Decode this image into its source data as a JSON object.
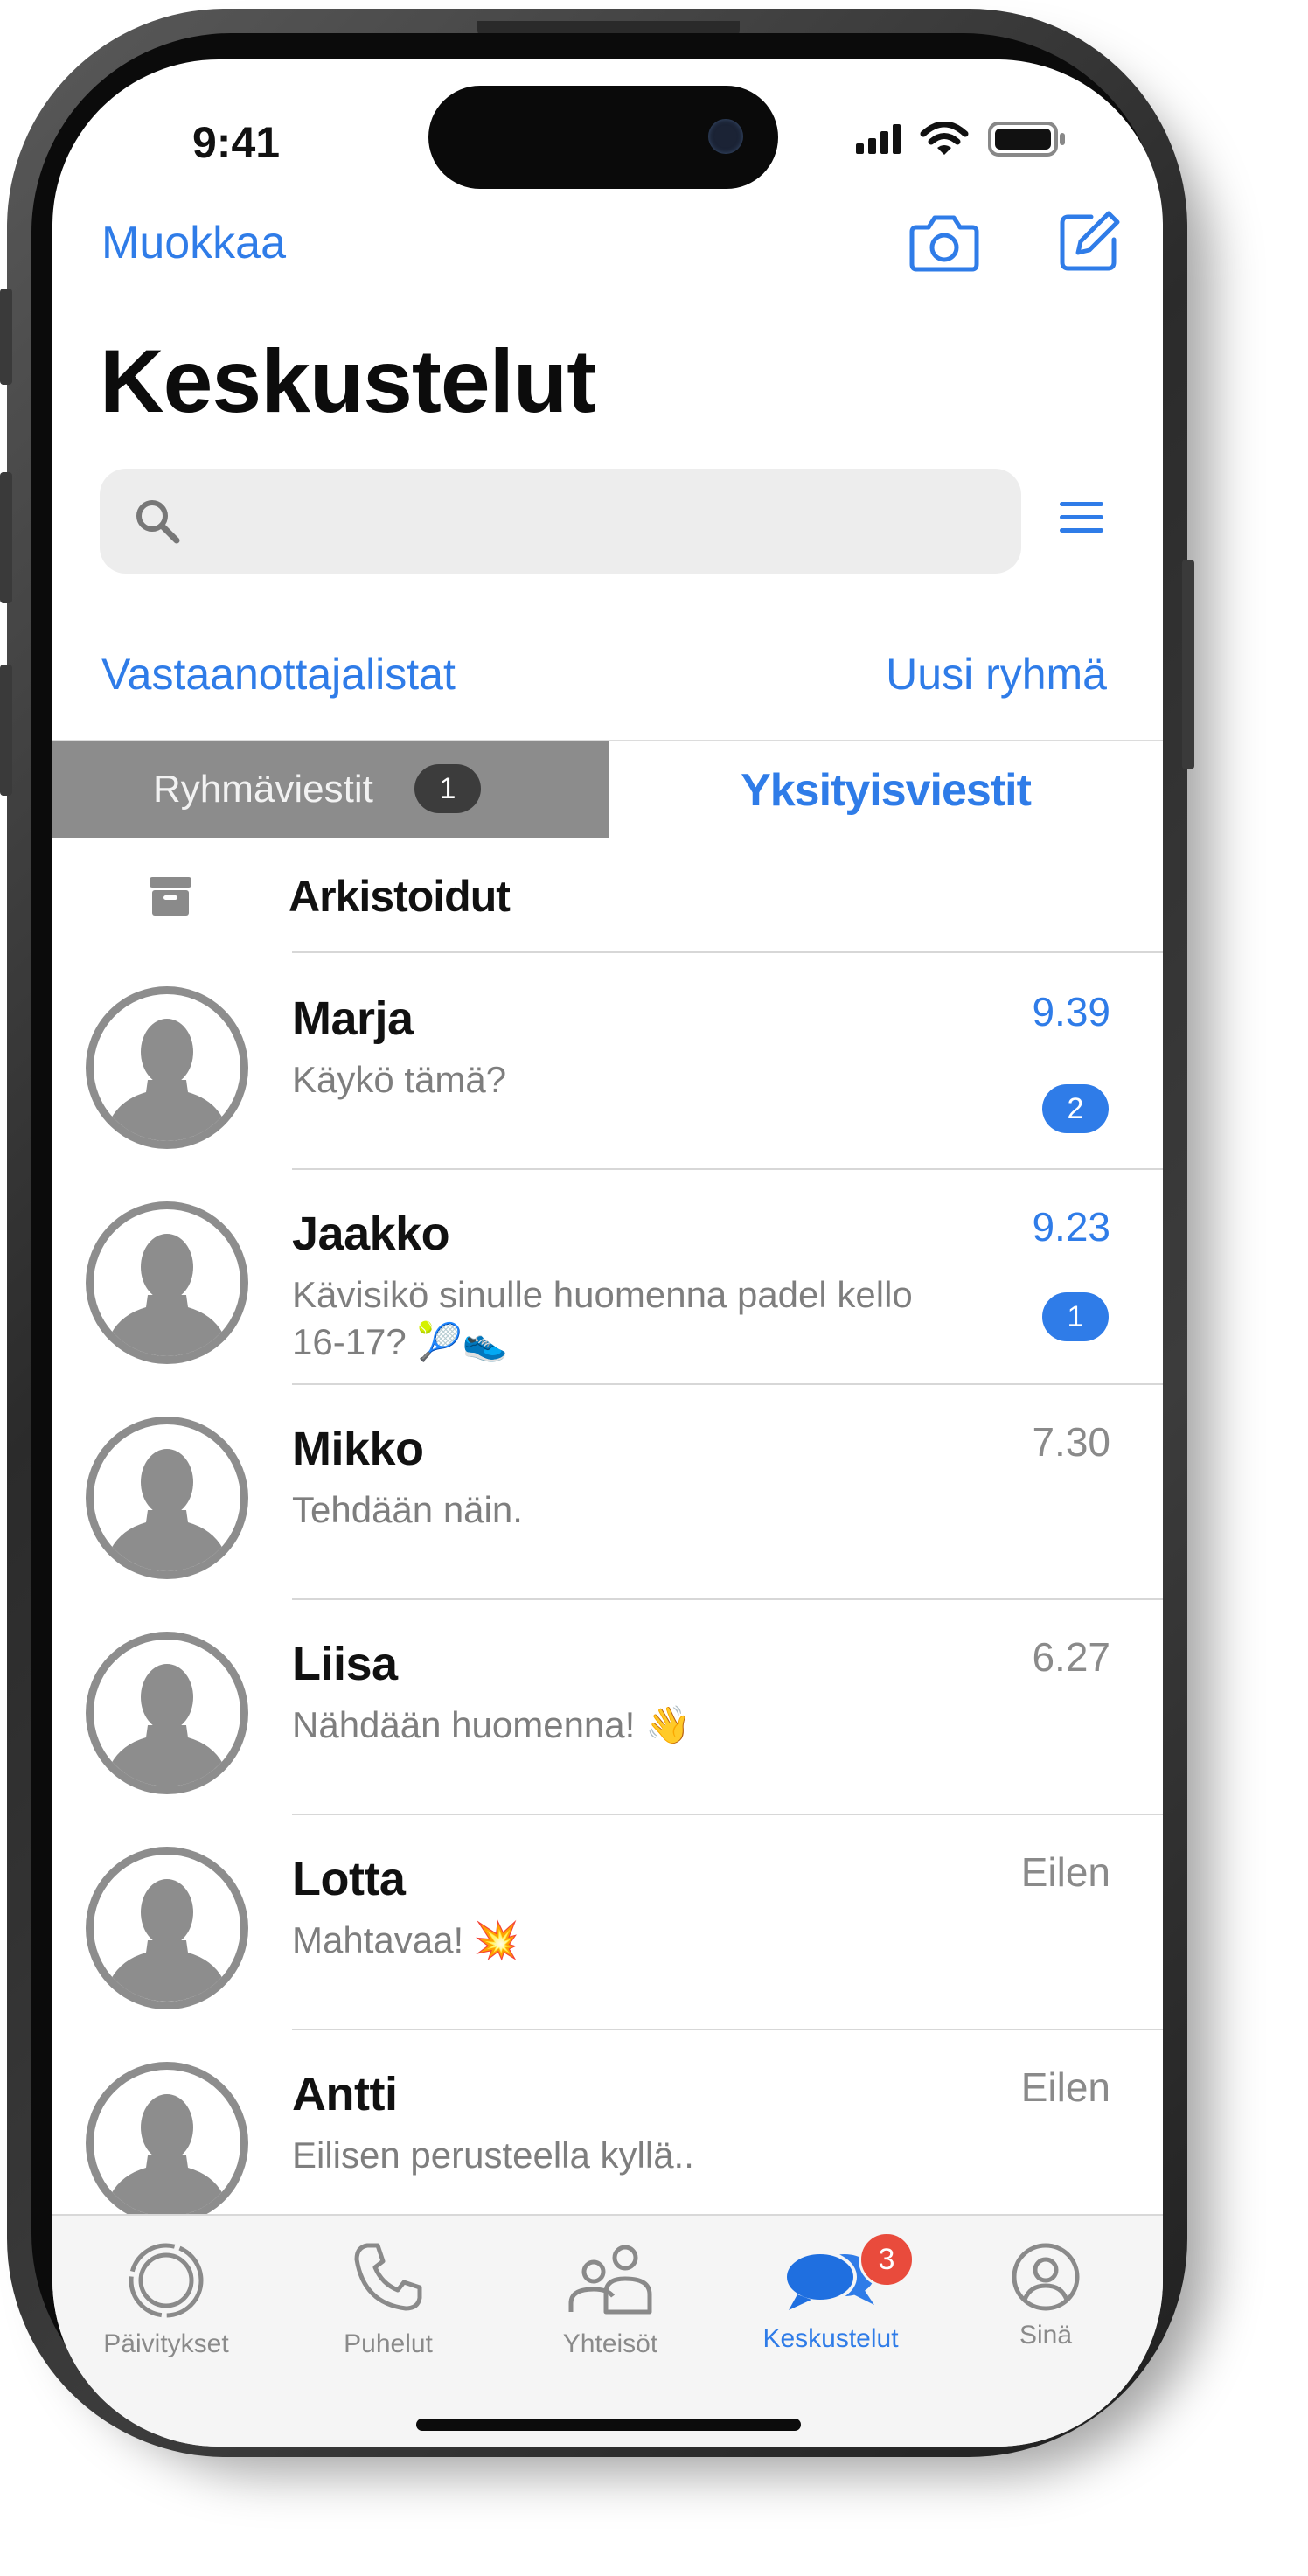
{
  "status_bar": {
    "time": "9:41"
  },
  "header": {
    "edit_label": "Muokkaa",
    "title": "Keskustelut",
    "broadcast_lists_label": "Vastaanottajalistat",
    "new_group_label": "Uusi ryhmä"
  },
  "search": {
    "placeholder": ""
  },
  "segments": {
    "group_label": "Ryhmäviestit",
    "group_badge": "1",
    "private_label": "Yksityisviestit"
  },
  "archived_label": "Arkistoidut",
  "chats": [
    {
      "name": "Marja",
      "preview": "Käykö tämä?",
      "time": "9.39",
      "unread": "2",
      "time_color": "#2f7ce8"
    },
    {
      "name": "Jaakko",
      "preview": "Kävisikö sinulle huomenna padel kello 16-17?",
      "emoji": "🎾👟",
      "time": "9.23",
      "unread": "1",
      "time_color": "#2f7ce8"
    },
    {
      "name": "Mikko",
      "preview": "Tehdään näin.",
      "time": "7.30",
      "unread": "",
      "time_color": "#8a8a8a"
    },
    {
      "name": "Liisa",
      "preview": "Nähdään huomenna!",
      "emoji": "👋",
      "time": "6.27",
      "unread": "",
      "time_color": "#8a8a8a"
    },
    {
      "name": "Lotta",
      "preview": "Mahtavaa!",
      "emoji": "💥",
      "time": "Eilen",
      "unread": "",
      "time_color": "#8a8a8a"
    },
    {
      "name": "Antti",
      "preview": "Eilisen perusteella kyllä..",
      "time": "Eilen",
      "unread": "",
      "time_color": "#8a8a8a"
    }
  ],
  "tabbar": {
    "updates": "Päivitykset",
    "calls": "Puhelut",
    "communities": "Yhteisöt",
    "chats": "Keskustelut",
    "chats_badge": "3",
    "you": "Sinä"
  },
  "colors": {
    "accent": "#2f7ce8",
    "badge_red": "#e94b3c",
    "avatar_gray": "#8d8d8d"
  },
  "icons": [
    "camera-icon",
    "compose-icon",
    "search-icon",
    "filter-icon",
    "archive-icon",
    "updates-icon",
    "phone-icon",
    "communities-icon",
    "chat-bubbles-icon",
    "profile-icon"
  ]
}
